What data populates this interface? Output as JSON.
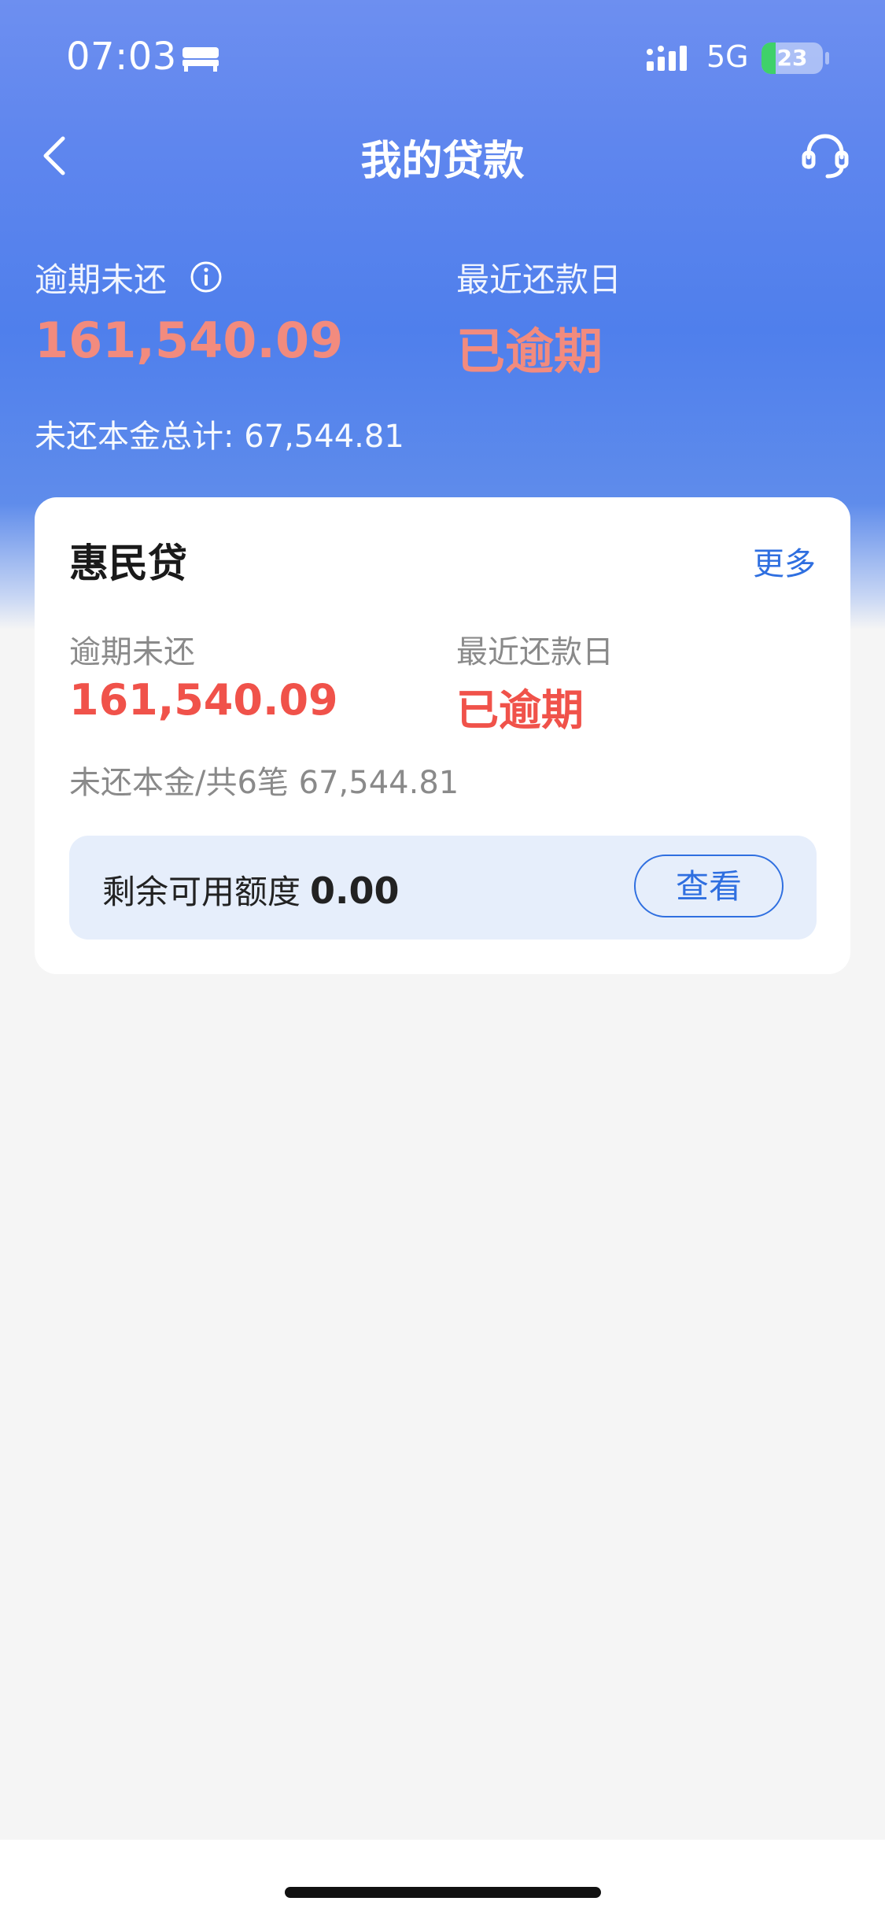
{
  "status_bar": {
    "time": "07:03",
    "network": "5G",
    "battery_level": "23",
    "battery_fraction": 0.23,
    "icons": [
      "bed-icon",
      "signal-icon",
      "battery-charging-icon"
    ]
  },
  "nav": {
    "title": "我的贷款",
    "icons": [
      "back-chevron-icon",
      "customer-service-headset-icon"
    ]
  },
  "summary": {
    "overdue_label": "逾期未还",
    "overdue_value": "161,540.09",
    "due_date_label": "最近还款日",
    "due_date_value": "已逾期",
    "principal_total": "未还本金总计: 67,544.81"
  },
  "loan_card": {
    "name": "惠民贷",
    "more_link": "更多",
    "overdue_label": "逾期未还",
    "overdue_value": "161,540.09",
    "due_date_label": "最近还款日",
    "due_date_value": "已逾期",
    "principal_line": "未还本金/共6笔 67,544.81",
    "credit_label": "剩余可用额度",
    "credit_value": "0.00",
    "view_button": "查看"
  },
  "colors": {
    "header_blue": "#5b86ee",
    "overdue_red_header": "#f28b7e",
    "overdue_red_card": "#f0524a",
    "link_blue": "#2f6fe0",
    "credit_box_bg": "#e6eefb"
  }
}
